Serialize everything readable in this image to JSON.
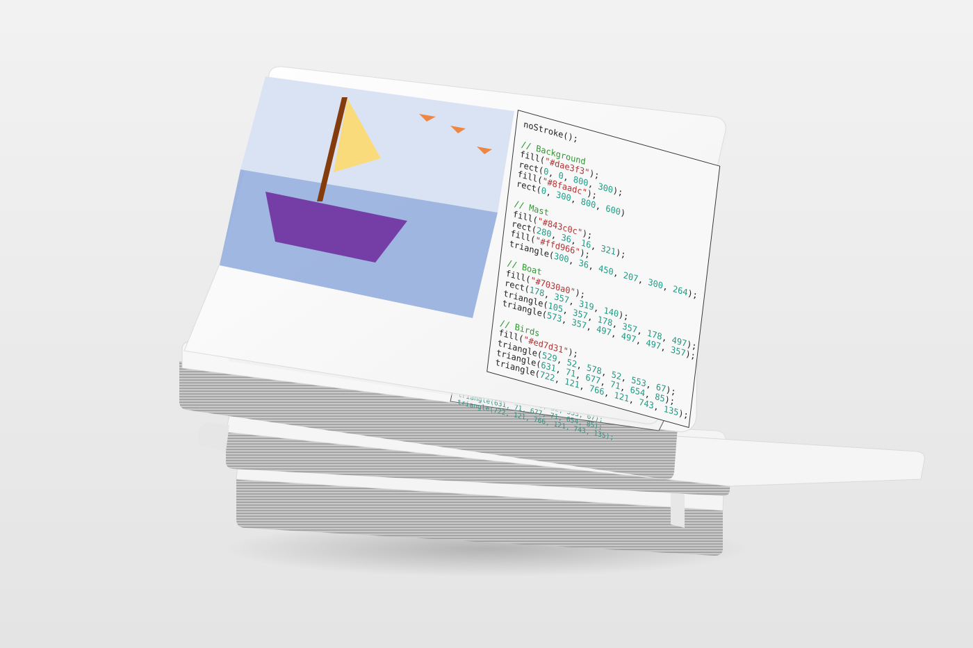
{
  "colors": {
    "background": "#ececec",
    "card_white": "#ffffff",
    "sky": "#dae3f3",
    "sea": "#8faadc",
    "mast": "#843c0c",
    "sail": "#ffd966",
    "boat": "#7030a0",
    "birds": "#ed7d31",
    "comment": "#2e9a2e",
    "string": "#b33232",
    "number": "#1f9a85"
  },
  "illustration": {
    "subject": "sailboat-scene",
    "parts": [
      "sky",
      "sea",
      "mast",
      "sail",
      "hull",
      "bird",
      "bird",
      "bird"
    ]
  },
  "code": {
    "lines": [
      [
        {
          "t": "noStroke();",
          "c": "p"
        }
      ],
      [],
      [
        {
          "t": "// Background",
          "c": "c"
        }
      ],
      [
        {
          "t": "fill(",
          "c": "p"
        },
        {
          "t": "\"#dae3f3\"",
          "c": "s"
        },
        {
          "t": ");",
          "c": "p"
        }
      ],
      [
        {
          "t": "rect(",
          "c": "p"
        },
        {
          "t": "0",
          "c": "n"
        },
        {
          "t": ", ",
          "c": "p"
        },
        {
          "t": "0",
          "c": "n"
        },
        {
          "t": ", ",
          "c": "p"
        },
        {
          "t": "800",
          "c": "n"
        },
        {
          "t": ", ",
          "c": "p"
        },
        {
          "t": "300",
          "c": "n"
        },
        {
          "t": ");",
          "c": "p"
        }
      ],
      [
        {
          "t": "fill(",
          "c": "p"
        },
        {
          "t": "\"#8faadc\"",
          "c": "s"
        },
        {
          "t": ");",
          "c": "p"
        }
      ],
      [
        {
          "t": "rect(",
          "c": "p"
        },
        {
          "t": "0",
          "c": "n"
        },
        {
          "t": ", ",
          "c": "p"
        },
        {
          "t": "300",
          "c": "n"
        },
        {
          "t": ", ",
          "c": "p"
        },
        {
          "t": "800",
          "c": "n"
        },
        {
          "t": ", ",
          "c": "p"
        },
        {
          "t": "600",
          "c": "n"
        },
        {
          "t": ")",
          "c": "p"
        }
      ],
      [],
      [
        {
          "t": "// Mast",
          "c": "c"
        }
      ],
      [
        {
          "t": "fill(",
          "c": "p"
        },
        {
          "t": "\"#843c0c\"",
          "c": "s"
        },
        {
          "t": ");",
          "c": "p"
        }
      ],
      [
        {
          "t": "rect(",
          "c": "p"
        },
        {
          "t": "280",
          "c": "n"
        },
        {
          "t": ", ",
          "c": "p"
        },
        {
          "t": "36",
          "c": "n"
        },
        {
          "t": ", ",
          "c": "p"
        },
        {
          "t": "16",
          "c": "n"
        },
        {
          "t": ", ",
          "c": "p"
        },
        {
          "t": "321",
          "c": "n"
        },
        {
          "t": ");",
          "c": "p"
        }
      ],
      [
        {
          "t": "fill(",
          "c": "p"
        },
        {
          "t": "\"#ffd966\"",
          "c": "s"
        },
        {
          "t": ");",
          "c": "p"
        }
      ],
      [
        {
          "t": "triangle(",
          "c": "p"
        },
        {
          "t": "300",
          "c": "n"
        },
        {
          "t": ", ",
          "c": "p"
        },
        {
          "t": "36",
          "c": "n"
        },
        {
          "t": ", ",
          "c": "p"
        },
        {
          "t": "450",
          "c": "n"
        },
        {
          "t": ", ",
          "c": "p"
        },
        {
          "t": "207",
          "c": "n"
        },
        {
          "t": ", ",
          "c": "p"
        },
        {
          "t": "300",
          "c": "n"
        },
        {
          "t": ", ",
          "c": "p"
        },
        {
          "t": "264",
          "c": "n"
        },
        {
          "t": ");",
          "c": "p"
        }
      ],
      [],
      [
        {
          "t": "// Boat",
          "c": "c"
        }
      ],
      [
        {
          "t": "fill(",
          "c": "p"
        },
        {
          "t": "\"#7030a0\"",
          "c": "s"
        },
        {
          "t": ");",
          "c": "p"
        }
      ],
      [
        {
          "t": "rect(",
          "c": "p"
        },
        {
          "t": "178",
          "c": "n"
        },
        {
          "t": ", ",
          "c": "p"
        },
        {
          "t": "357",
          "c": "n"
        },
        {
          "t": ", ",
          "c": "p"
        },
        {
          "t": "319",
          "c": "n"
        },
        {
          "t": ", ",
          "c": "p"
        },
        {
          "t": "140",
          "c": "n"
        },
        {
          "t": ");",
          "c": "p"
        }
      ],
      [
        {
          "t": "triangle(",
          "c": "p"
        },
        {
          "t": "105",
          "c": "n"
        },
        {
          "t": ", ",
          "c": "p"
        },
        {
          "t": "357",
          "c": "n"
        },
        {
          "t": ", ",
          "c": "p"
        },
        {
          "t": "178",
          "c": "n"
        },
        {
          "t": ", ",
          "c": "p"
        },
        {
          "t": "357",
          "c": "n"
        },
        {
          "t": ", ",
          "c": "p"
        },
        {
          "t": "178",
          "c": "n"
        },
        {
          "t": ", ",
          "c": "p"
        },
        {
          "t": "497",
          "c": "n"
        },
        {
          "t": ");",
          "c": "p"
        }
      ],
      [
        {
          "t": "triangle(",
          "c": "p"
        },
        {
          "t": "573",
          "c": "n"
        },
        {
          "t": ", ",
          "c": "p"
        },
        {
          "t": "357",
          "c": "n"
        },
        {
          "t": ", ",
          "c": "p"
        },
        {
          "t": "497",
          "c": "n"
        },
        {
          "t": ", ",
          "c": "p"
        },
        {
          "t": "497",
          "c": "n"
        },
        {
          "t": ", ",
          "c": "p"
        },
        {
          "t": "497",
          "c": "n"
        },
        {
          "t": ", ",
          "c": "p"
        },
        {
          "t": "357",
          "c": "n"
        },
        {
          "t": ");",
          "c": "p"
        }
      ],
      [],
      [
        {
          "t": "// Birds",
          "c": "c"
        }
      ],
      [
        {
          "t": "fill(",
          "c": "p"
        },
        {
          "t": "\"#ed7d31\"",
          "c": "s"
        },
        {
          "t": ");",
          "c": "p"
        }
      ],
      [
        {
          "t": "triangle(",
          "c": "p"
        },
        {
          "t": "529",
          "c": "n"
        },
        {
          "t": ", ",
          "c": "p"
        },
        {
          "t": "52",
          "c": "n"
        },
        {
          "t": ", ",
          "c": "p"
        },
        {
          "t": "578",
          "c": "n"
        },
        {
          "t": ", ",
          "c": "p"
        },
        {
          "t": "52",
          "c": "n"
        },
        {
          "t": ", ",
          "c": "p"
        },
        {
          "t": "553",
          "c": "n"
        },
        {
          "t": ", ",
          "c": "p"
        },
        {
          "t": "67",
          "c": "n"
        },
        {
          "t": ");",
          "c": "p"
        }
      ],
      [
        {
          "t": "triangle(",
          "c": "p"
        },
        {
          "t": "631",
          "c": "n"
        },
        {
          "t": ", ",
          "c": "p"
        },
        {
          "t": "71",
          "c": "n"
        },
        {
          "t": ", ",
          "c": "p"
        },
        {
          "t": "677",
          "c": "n"
        },
        {
          "t": ", ",
          "c": "p"
        },
        {
          "t": "71",
          "c": "n"
        },
        {
          "t": ", ",
          "c": "p"
        },
        {
          "t": "654",
          "c": "n"
        },
        {
          "t": ", ",
          "c": "p"
        },
        {
          "t": "85",
          "c": "n"
        },
        {
          "t": ");",
          "c": "p"
        }
      ],
      [
        {
          "t": "triangle(",
          "c": "p"
        },
        {
          "t": "722",
          "c": "n"
        },
        {
          "t": ", ",
          "c": "p"
        },
        {
          "t": "121",
          "c": "n"
        },
        {
          "t": ", ",
          "c": "p"
        },
        {
          "t": "766",
          "c": "n"
        },
        {
          "t": ", ",
          "c": "p"
        },
        {
          "t": "121",
          "c": "n"
        },
        {
          "t": ", ",
          "c": "p"
        },
        {
          "t": "743",
          "c": "n"
        },
        {
          "t": ", ",
          "c": "p"
        },
        {
          "t": "135",
          "c": "n"
        },
        {
          "t": ");",
          "c": "p"
        }
      ]
    ]
  }
}
